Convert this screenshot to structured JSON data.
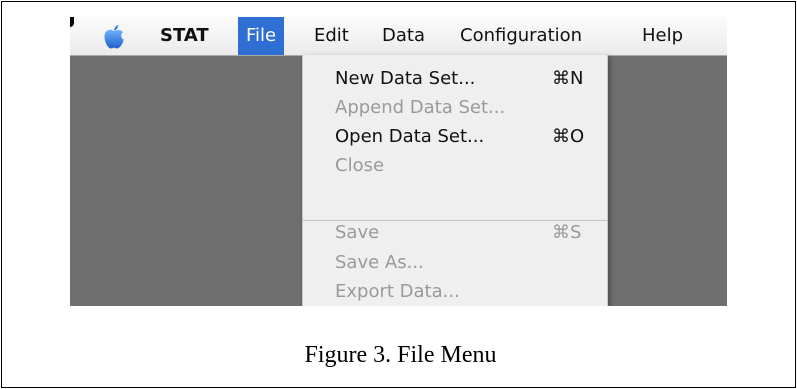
{
  "menubar": {
    "app_name": "STAT",
    "menus": [
      "File",
      "Edit",
      "Data",
      "Configuration",
      "Help"
    ],
    "active_menu": "File"
  },
  "file_menu": {
    "items": [
      {
        "label": "New Data Set...",
        "shortcut": "⌘N",
        "enabled": true
      },
      {
        "label": "Append Data Set...",
        "shortcut": "",
        "enabled": false
      },
      {
        "label": "Open Data Set...",
        "shortcut": "⌘O",
        "enabled": true
      },
      {
        "label": "Close",
        "shortcut": "",
        "enabled": false
      },
      {
        "label": "Save",
        "shortcut": "⌘S",
        "enabled": false
      },
      {
        "label": "Save As...",
        "shortcut": "",
        "enabled": false
      },
      {
        "label": "Export Data...",
        "shortcut": "",
        "enabled": false
      }
    ]
  },
  "caption": "Figure 3.  File Menu",
  "colors": {
    "highlight": "#2f6fd3",
    "apple_logo": "#2f7de1",
    "desktop": "#6f6f6f"
  },
  "icons": {
    "apple": "apple-icon"
  }
}
